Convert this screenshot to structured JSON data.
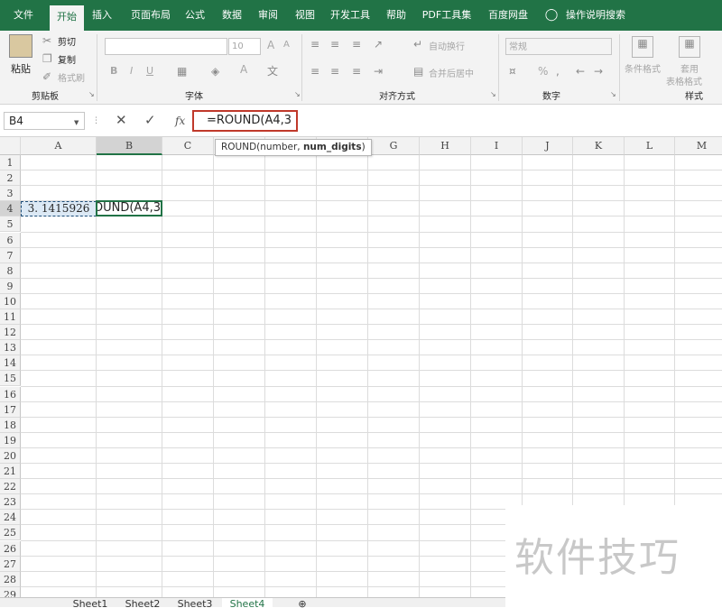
{
  "menu": {
    "tabs": [
      "文件",
      "开始",
      "插入",
      "页面布局",
      "公式",
      "数据",
      "审阅",
      "视图",
      "开发工具",
      "帮助",
      "PDF工具集",
      "百度网盘",
      "操作说明搜索"
    ],
    "active": "开始"
  },
  "ribbon": {
    "clipboard": {
      "paste": "粘贴",
      "cut": "剪切",
      "copy": "复制",
      "format_painter": "格式刷",
      "group": "剪贴板"
    },
    "font": {
      "font_size": "10",
      "group": "字体",
      "bold": "B",
      "italic": "I",
      "underline": "U",
      "inc": "A",
      "dec": "A",
      "color": "A"
    },
    "alignment": {
      "wrap": "自动换行",
      "merge": "合并后居中",
      "group": "对齐方式"
    },
    "number": {
      "format": "常规",
      "percent": "%",
      "group": "数字"
    },
    "styles": {
      "cond": "条件格式",
      "table": "套用",
      "table2": "表格格式",
      "group": "样式"
    }
  },
  "formula_bar": {
    "name_box": "B4",
    "fx": "fx",
    "formula": "=ROUND(A4,3",
    "cancel": "✕",
    "enter": "✓"
  },
  "tooltip": {
    "func": "ROUND(number, ",
    "arg": "num_digits",
    ")": ")",
    "close": ")"
  },
  "grid": {
    "columns": [
      "A",
      "B",
      "C",
      "D",
      "E",
      "F",
      "G",
      "H",
      "I",
      "J",
      "K",
      "L",
      "M"
    ],
    "rows": [
      "1",
      "2",
      "3",
      "4",
      "5",
      "6",
      "7",
      "8",
      "9",
      "10",
      "11",
      "12",
      "13",
      "14",
      "15",
      "16",
      "17",
      "18",
      "19",
      "20",
      "21",
      "22",
      "23",
      "24",
      "25",
      "26",
      "27",
      "28",
      "29"
    ],
    "a4": "3. 1415926",
    "b4": "OUND(A4,3"
  },
  "sheets": [
    "Sheet1",
    "Sheet2",
    "Sheet3",
    "Sheet4"
  ],
  "active_sheet": "Sheet4",
  "watermark": "软件技巧"
}
